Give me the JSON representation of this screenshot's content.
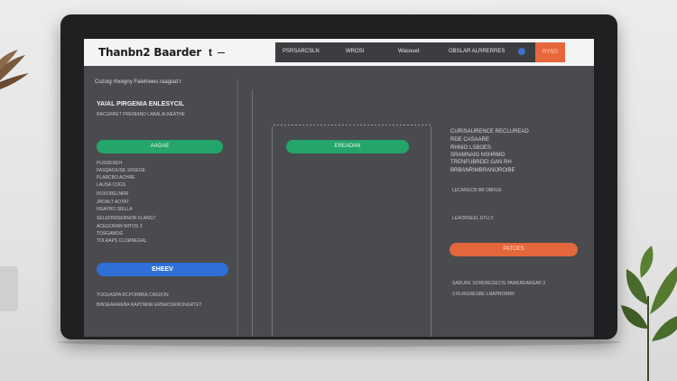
{
  "window": {
    "title": "Thanbn2 Baarder",
    "title_suffix": "t"
  },
  "topnav": {
    "items": [
      "PSRSARCSLN",
      "WROSI",
      "Wasouet",
      "OBSLAR  ALRRERRES"
    ],
    "accent_label": "RYSO"
  },
  "left_panel": {
    "intro": "Cuzoig rhxegny Falehiwes raagiad t",
    "heading": "YAIAL PIRGENIA ENLESYCIL",
    "subheading": "RACURRET PRENIAND LABALALNEATHE",
    "primary_button": "AAGAE",
    "fields": [
      "PLRIZEREH",
      "FASQAGIUSE 1RSEOE",
      "PLARCBO ACHRE",
      "LAUSA COGS",
      "ROXORELNRR",
      "JROALT AOTAT",
      "HGAYRO SIELLA",
      "SELEFRRSERNOR FLANGT",
      "ACEGORAN WITOS 3",
      "TOSGAMOG",
      "TOLRAPS CLORNEGAL"
    ],
    "blue_button": "EHEEV",
    "footer_1": "YUGUASPA RCPONBRA CREDON",
    "footer_2": "BINSEARAIEBA RAPDNNR ERNAOSRRONGRTET"
  },
  "middle_panel": {
    "button": "EREADAN"
  },
  "right_panel": {
    "lines": [
      "CURISAURENCE RECLUREAD",
      "RDE CASAARE",
      "RHNIO LSBOES",
      "SRAMNAIG NSHRMO",
      "TRENFUBRDEI GAN RH",
      "BRBANRIMBRANOROIBE"
    ],
    "meta_1": "LECANGCB BB OBRUE",
    "meta_2": "LEAORSEEL ETLLY",
    "orange_button": "PATOES",
    "note_1": "SARURE SORDREGECIS PAWEREAREAR 3",
    "note_2": "3 RLRIGRESBE LRAPROBRR"
  }
}
